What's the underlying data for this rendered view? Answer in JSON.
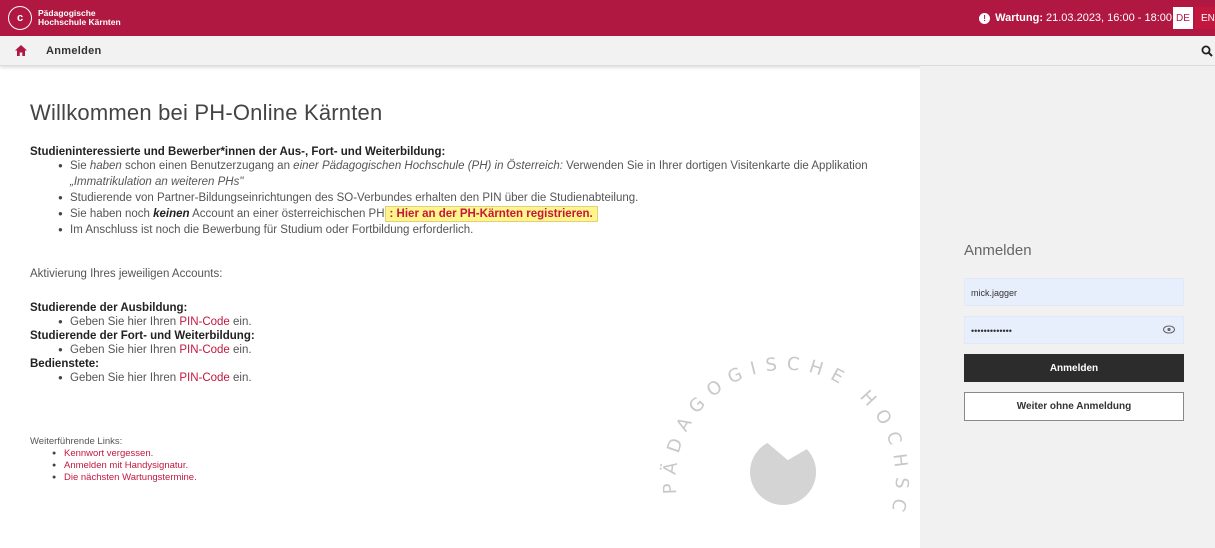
{
  "header": {
    "logo_mark": "c",
    "logo_line1": "Pädagogische",
    "logo_line2": "Hochschule Kärnten",
    "maintenance_label": "Wartung:",
    "maintenance_value": "21.03.2023, 16:00 - 18:00",
    "lang_de": "DE",
    "lang_en": "EN",
    "brand_color": "#b01842"
  },
  "breadcrumb": {
    "home_icon": "home-icon",
    "label": "Anmelden",
    "search_icon": "search-icon"
  },
  "main": {
    "title": "Willkommen bei PH-Online Kärnten",
    "applicants_heading": "Studieninteressierte und Bewerber*innen der Aus-, Fort- und Weiterbildung:",
    "bullet1_a": "Sie ",
    "bullet1_b": "haben",
    "bullet1_c": " schon einen Benutzerzugang an ",
    "bullet1_d": "einer Pädagogischen Hochschule (PH) in Österreich:",
    "bullet1_e": " Verwenden Sie in Ihrer dortigen Visitenkarte die Applikation ",
    "bullet1_f": "„Immatrikulation an weiteren PHs\"",
    "bullet2": "Studierende von Partner-Bildungseinrichtungen des SO-Verbundes erhalten den PIN über die Studienabteilung.",
    "bullet3_a": "Sie haben noch ",
    "bullet3_b": "keinen",
    "bullet3_c": " Account an einer österreichischen PH",
    "bullet3_link": ": Hier an der PH-Kärnten registrieren.",
    "bullet4": "Im Anschluss ist noch die Bewerbung für Studium oder Fortbildung erforderlich.",
    "activation": "Aktivierung Ihres jeweiligen Accounts:",
    "sec1_heading": "Studierende der Ausbildung:",
    "sec2_heading": "Studierende der Fort- und Weiterbildung:",
    "sec3_heading": "Bedienstete:",
    "pin_a": "Geben Sie hier Ihren ",
    "pin_link": "PIN-Code",
    "pin_b": " ein.",
    "links_heading": "Weiterführende Links:",
    "link1": "Kennwort vergessen.",
    "link2": "Anmelden mit Handysignatur.",
    "link3": "Die nächsten Wartungstermine.",
    "seal_text": "PÄDAGOGISCHE HOCHSCHULE"
  },
  "login": {
    "title": "Anmelden",
    "username_value": "mick.jagger",
    "password_value": "•••••••••••••",
    "eye_icon": "eye-icon",
    "login_button": "Anmelden",
    "guest_button": "Weiter ohne Anmeldung"
  }
}
